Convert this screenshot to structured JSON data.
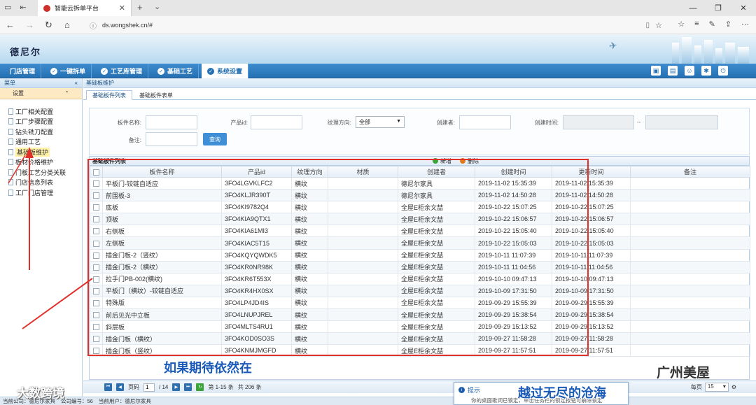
{
  "browser": {
    "tab_title": "智能云拆单平台",
    "url": "ds.wongshek.cn/#"
  },
  "app": {
    "brand": "德尼尔",
    "menu": [
      {
        "label": "门店管理",
        "icon": ""
      },
      {
        "label": "一键拆单",
        "icon": "✓"
      },
      {
        "label": "工艺库管理",
        "icon": "✓"
      },
      {
        "label": "基础工艺",
        "icon": "✓"
      },
      {
        "label": "系统设置",
        "icon": "✓"
      }
    ]
  },
  "sidebar": {
    "header": "菜单",
    "collapse_glyph": "«",
    "section": "设置",
    "items": [
      {
        "label": "工厂相关配置"
      },
      {
        "label": "工厂步骤配置"
      },
      {
        "label": "钻头铣刀配置"
      },
      {
        "label": "通用工艺"
      },
      {
        "label": "基础板维护"
      },
      {
        "label": "板材价格维护"
      },
      {
        "label": "门板工艺分类关联"
      },
      {
        "label": "门店信息列表"
      },
      {
        "label": "工厂门店管理"
      }
    ]
  },
  "content": {
    "breadcrumb": "基础板维护",
    "tabs": [
      "基础板件列表",
      "基础板件表单"
    ],
    "search": {
      "label_name": "板件名称:",
      "label_product": "产品id:",
      "label_grain": "纹理方向:",
      "grain_value": "全部",
      "label_creator": "创建者:",
      "label_created": "创建时间:",
      "label_note": "备注:",
      "date_sep": "--",
      "query_button": "查询"
    },
    "grid": {
      "title": "基础板件列表",
      "add_label": "新增",
      "delete_label": "删除",
      "columns": [
        "板件名称",
        "产品id",
        "纹理方向",
        "材质",
        "创建者",
        "创建时间",
        "更新时间",
        "备注"
      ],
      "rows": [
        [
          "平板门-铰链自适应",
          "3FO4LGVKLFC2",
          "横纹",
          "",
          "德尼尔家具",
          "2019-11-02 15:35:39",
          "2019-11-02 15:35:39",
          ""
        ],
        [
          "前围板-3",
          "3FO4KLJR390T",
          "横纹",
          "",
          "德尼尔家具",
          "2019-11-02 14:50:28",
          "2019-11-02 14:50:28",
          ""
        ],
        [
          "底板",
          "3FO4KI9782Q4",
          "横纹",
          "",
          "全屋E柜余文喆",
          "2019-10-22 15:07:25",
          "2019-10-22 15:07:25",
          ""
        ],
        [
          "顶板",
          "3FO4KIA9QTX1",
          "横纹",
          "",
          "全屋E柜余文喆",
          "2019-10-22 15:06:57",
          "2019-10-22 15:06:57",
          ""
        ],
        [
          "右侧板",
          "3FO4KIA61MI3",
          "横纹",
          "",
          "全屋E柜余文喆",
          "2019-10-22 15:05:40",
          "2019-10-22 15:05:40",
          ""
        ],
        [
          "左侧板",
          "3FO4KIAC5T15",
          "横纹",
          "",
          "全屋E柜余文喆",
          "2019-10-22 15:05:03",
          "2019-10-22 15:05:03",
          ""
        ],
        [
          "插金门板-2（竖纹）",
          "3FO4KQYQWDK5",
          "横纹",
          "",
          "全屋E柜余文喆",
          "2019-10-11 11:07:39",
          "2019-10-11 11:07:39",
          ""
        ],
        [
          "插金门板-2（横纹）",
          "3FO4KR0NR98K",
          "横纹",
          "",
          "全屋E柜余文喆",
          "2019-10-11 11:04:56",
          "2019-10-11 11:04:56",
          ""
        ],
        [
          "拉手门PB-002(横纹)",
          "3FO4KR6T553X",
          "横纹",
          "",
          "全屋E柜余文喆",
          "2019-10-10 09:47:13",
          "2019-10-10 09:47:13",
          ""
        ],
        [
          "平板门（横纹）-铰链自适应",
          "3FO4KR4HX0SX",
          "横纹",
          "",
          "全屋E柜余文喆",
          "2019-10-09 17:31:50",
          "2019-10-09 17:31:50",
          ""
        ],
        [
          "特殊版",
          "3FO4LP4JD4IS",
          "横纹",
          "",
          "全屋E柜余文喆",
          "2019-09-29 15:55:39",
          "2019-09-29 15:55:39",
          ""
        ],
        [
          "前后见光中立板",
          "3FO4LNUPJREL",
          "横纹",
          "",
          "全屋E柜余文喆",
          "2019-09-29 15:38:54",
          "2019-09-29 15:38:54",
          ""
        ],
        [
          "斜层板",
          "3FO4MLTS4RU1",
          "横纹",
          "",
          "全屋E柜余文喆",
          "2019-09-29 15:13:52",
          "2019-09-29 15:13:52",
          ""
        ],
        [
          "插金门板（横纹）",
          "3FO4KOD0SO3S",
          "横纹",
          "",
          "全屋E柜余文喆",
          "2019-09-27 11:58:28",
          "2019-09-27 11:58:28",
          ""
        ],
        [
          "插金门板（竖纹）",
          "3FO4KNMJMGFD",
          "横纹",
          "",
          "全屋E柜余文喆",
          "2019-09-27 11:57:51",
          "2019-09-27 11:57:51",
          ""
        ]
      ]
    },
    "pager": {
      "page_label": "页码",
      "page_value": "1",
      "total_pages": "/ 14",
      "range_text": "第 1-15 条",
      "total_text": "共 206 条",
      "per_page_label": "每页",
      "per_page_value": "15"
    }
  },
  "status": {
    "company": "当前公司：德尼尔家具",
    "company_code": "公司编号：56",
    "user": "当前用户：德尼尔家具"
  },
  "tip": {
    "title": "提示",
    "message": "你的桌面歌词已锁定，单击任务栏的锁定按钮可解除锁定"
  },
  "overlay": {
    "caption_left": "如果期待依然在",
    "caption_right": "越过无尽的沧海",
    "watermark_left": "大数跨境",
    "watermark_right": "广州美屋"
  },
  "colors": {
    "menu_blue": "#2470b3",
    "annotation_red": "#e0302a",
    "link_blue": "#1c5fa8"
  }
}
